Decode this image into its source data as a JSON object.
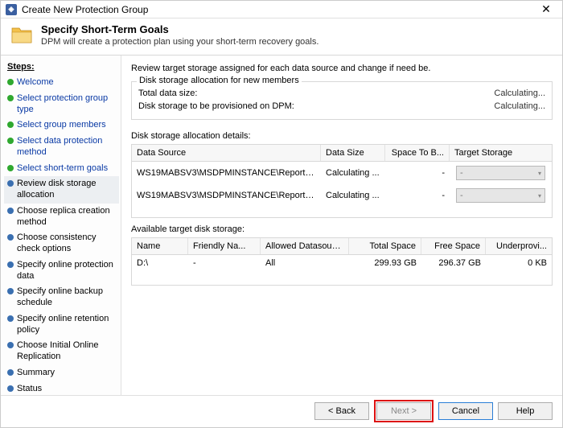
{
  "window": {
    "title": "Create New Protection Group"
  },
  "header": {
    "title": "Specify Short-Term Goals",
    "subtitle": "DPM will create a protection plan using your short-term recovery goals."
  },
  "steps": {
    "heading": "Steps:",
    "items": [
      {
        "label": "Welcome",
        "state": "done"
      },
      {
        "label": "Select protection group type",
        "state": "done"
      },
      {
        "label": "Select group members",
        "state": "done"
      },
      {
        "label": "Select data protection method",
        "state": "done"
      },
      {
        "label": "Select short-term goals",
        "state": "done"
      },
      {
        "label": "Review disk storage allocation",
        "state": "current"
      },
      {
        "label": "Choose replica creation method",
        "state": "pending"
      },
      {
        "label": "Choose consistency check options",
        "state": "pending"
      },
      {
        "label": "Specify online protection data",
        "state": "pending"
      },
      {
        "label": "Specify online backup schedule",
        "state": "pending"
      },
      {
        "label": "Specify online retention policy",
        "state": "pending"
      },
      {
        "label": "Choose Initial Online Replication",
        "state": "pending"
      },
      {
        "label": "Summary",
        "state": "pending"
      },
      {
        "label": "Status",
        "state": "pending"
      }
    ]
  },
  "main": {
    "instruction": "Review target storage assigned for each data source and change if need be.",
    "new_members": {
      "legend": "Disk storage allocation for new members",
      "total_label": "Total data size:",
      "total_value": "Calculating...",
      "prov_label": "Disk storage to be provisioned on DPM:",
      "prov_value": "Calculating..."
    },
    "details_label": "Disk storage allocation details:",
    "alloc_columns": {
      "ds": "Data Source",
      "size": "Data Size",
      "space": "Space To B...",
      "target": "Target Storage"
    },
    "alloc_rows": [
      {
        "ds": "WS19MABSV3\\MSDPMINSTANCE\\ReportServe...",
        "size": "Calculating ...",
        "space": "-",
        "target": "-"
      },
      {
        "ds": "WS19MABSV3\\MSDPMINSTANCE\\ReportServe...",
        "size": "Calculating ...",
        "space": "-",
        "target": "-"
      }
    ],
    "avail_label": "Available target disk storage:",
    "avail_columns": {
      "name": "Name",
      "friendly": "Friendly Na...",
      "allowed": "Allowed Datasourc...",
      "total": "Total Space",
      "free": "Free Space",
      "under": "Underprovi..."
    },
    "avail_rows": [
      {
        "name": "D:\\",
        "friendly": "-",
        "allowed": "All",
        "total": "299.93 GB",
        "free": "296.37 GB",
        "under": "0 KB"
      }
    ]
  },
  "footer": {
    "back": "< Back",
    "next": "Next >",
    "cancel": "Cancel",
    "help": "Help"
  }
}
